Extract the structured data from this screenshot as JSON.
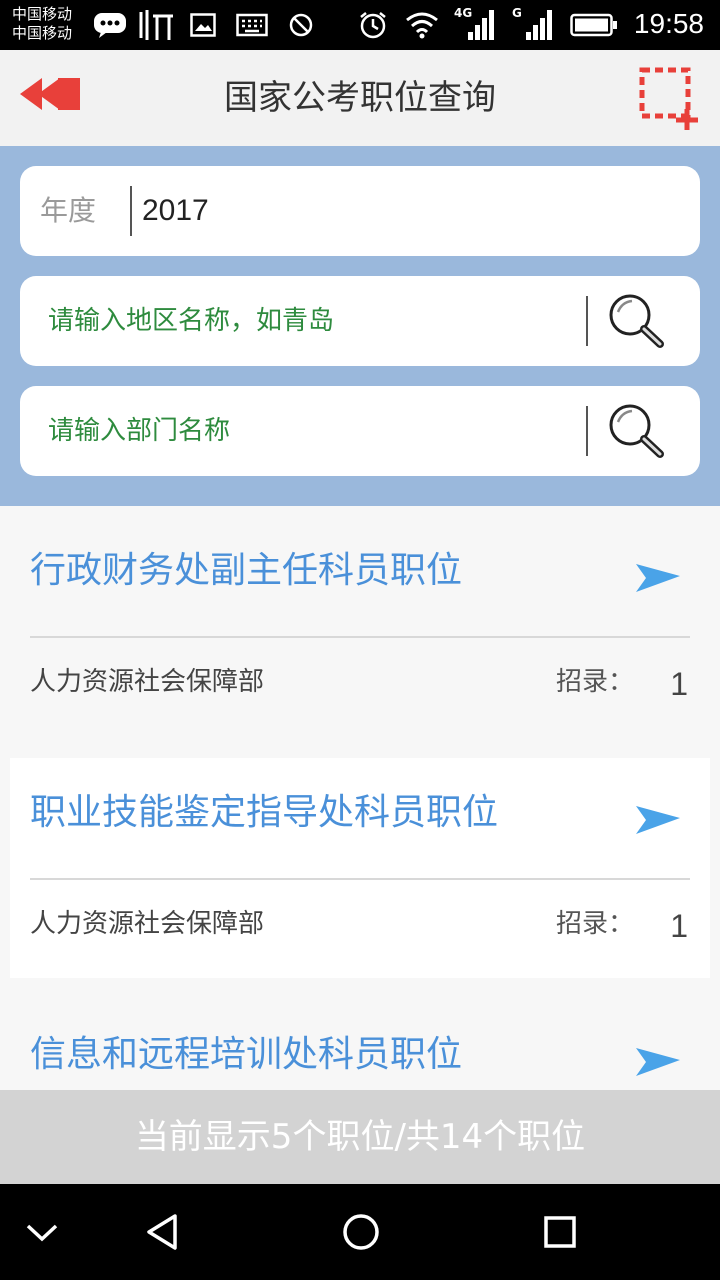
{
  "status_bar": {
    "carrier_line1": "中国移动",
    "carrier_line2": "中国移动",
    "signal_4g_label": "4G",
    "signal_g_label": "G",
    "time": "19:58",
    "icons": [
      "message-icon",
      "ting-app-icon",
      "image-icon",
      "keyboard-icon",
      "no-disturb-icon",
      "alarm-icon",
      "wifi-icon",
      "signal-icon",
      "battery-icon"
    ]
  },
  "header": {
    "title": "国家公考职位查询",
    "back_icon": "double-chevron-left-icon",
    "action_icon": "crop-add-icon",
    "accent_color": "#e8403a"
  },
  "search": {
    "year_label": "年度",
    "year_value": "2017",
    "region_placeholder": "请输入地区名称，如青岛",
    "department_placeholder": "请输入部门名称",
    "search_icon": "search-icon",
    "background_color": "#9ab8dc"
  },
  "jobs": [
    {
      "title": "行政财务处副主任科员职位",
      "department": "人力资源社会保障部",
      "hire_label": "招录：",
      "hire_count": "1"
    },
    {
      "title": "职业技能鉴定指导处科员职位",
      "department": "人力资源社会保障部",
      "hire_label": "招录：",
      "hire_count": "1"
    },
    {
      "title": "信息和远程培训处科员职位",
      "department": "",
      "hire_label": "",
      "hire_count": ""
    }
  ],
  "footer": {
    "summary": "当前显示5个职位/共14个职位"
  },
  "nav": {
    "icons": [
      "collapse-icon",
      "back-icon",
      "home-icon",
      "recents-icon"
    ]
  }
}
